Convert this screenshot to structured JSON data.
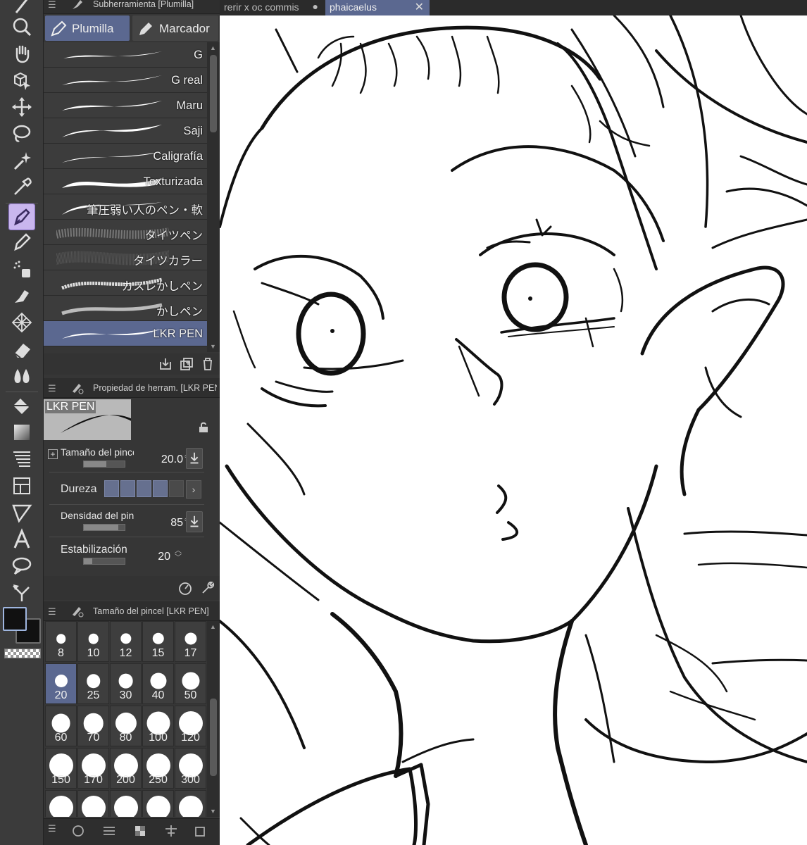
{
  "document_tabs": [
    {
      "label": "rerir x oc commis",
      "indicator": "●"
    },
    {
      "label": "phaicaelus",
      "close": "✕"
    }
  ],
  "subtool_panel": {
    "title": "Subherramienta [Plumilla]",
    "tabs": [
      {
        "label": "Plumilla",
        "icon": "pen-nib-icon"
      },
      {
        "label": "Marcador",
        "icon": "marker-icon"
      }
    ],
    "brushes": [
      {
        "name": "G"
      },
      {
        "name": "G real"
      },
      {
        "name": "Maru"
      },
      {
        "name": "Saji"
      },
      {
        "name": "Caligrafía"
      },
      {
        "name": "Texturizada"
      },
      {
        "name": "筆圧弱い人のペン・軟"
      },
      {
        "name": "タイツペン"
      },
      {
        "name": "タイツカラー"
      },
      {
        "name": "カスレかしペン"
      },
      {
        "name": "かしペン"
      },
      {
        "name": "LKR PEN"
      }
    ],
    "selected_brush": "LKR PEN"
  },
  "property_panel": {
    "title": "Propiedad de herram. [LKR PEN]",
    "preview_label": "LKR PEN",
    "brush_size_label": "Tamaño del pincel",
    "brush_size_value": "20.0",
    "hardness_label": "Dureza",
    "hardness_level": 4,
    "hardness_max": 5,
    "density_label": "Densidad del pincel",
    "density_value": "85",
    "stabilization_label": "Estabilización",
    "stabilization_value": "20"
  },
  "brush_size_panel": {
    "title": "Tamaño del pincel [LKR PEN]",
    "sizes": [
      "8",
      "10",
      "12",
      "15",
      "17",
      "20",
      "25",
      "30",
      "40",
      "50",
      "60",
      "70",
      "80",
      "100",
      "120",
      "150",
      "170",
      "200",
      "250",
      "300"
    ],
    "selected_size": "20"
  },
  "colors": {
    "accent": "#5b6890",
    "active_tool": "#c9b6ee",
    "main_color": "#111111",
    "sub_color": "#111111"
  }
}
